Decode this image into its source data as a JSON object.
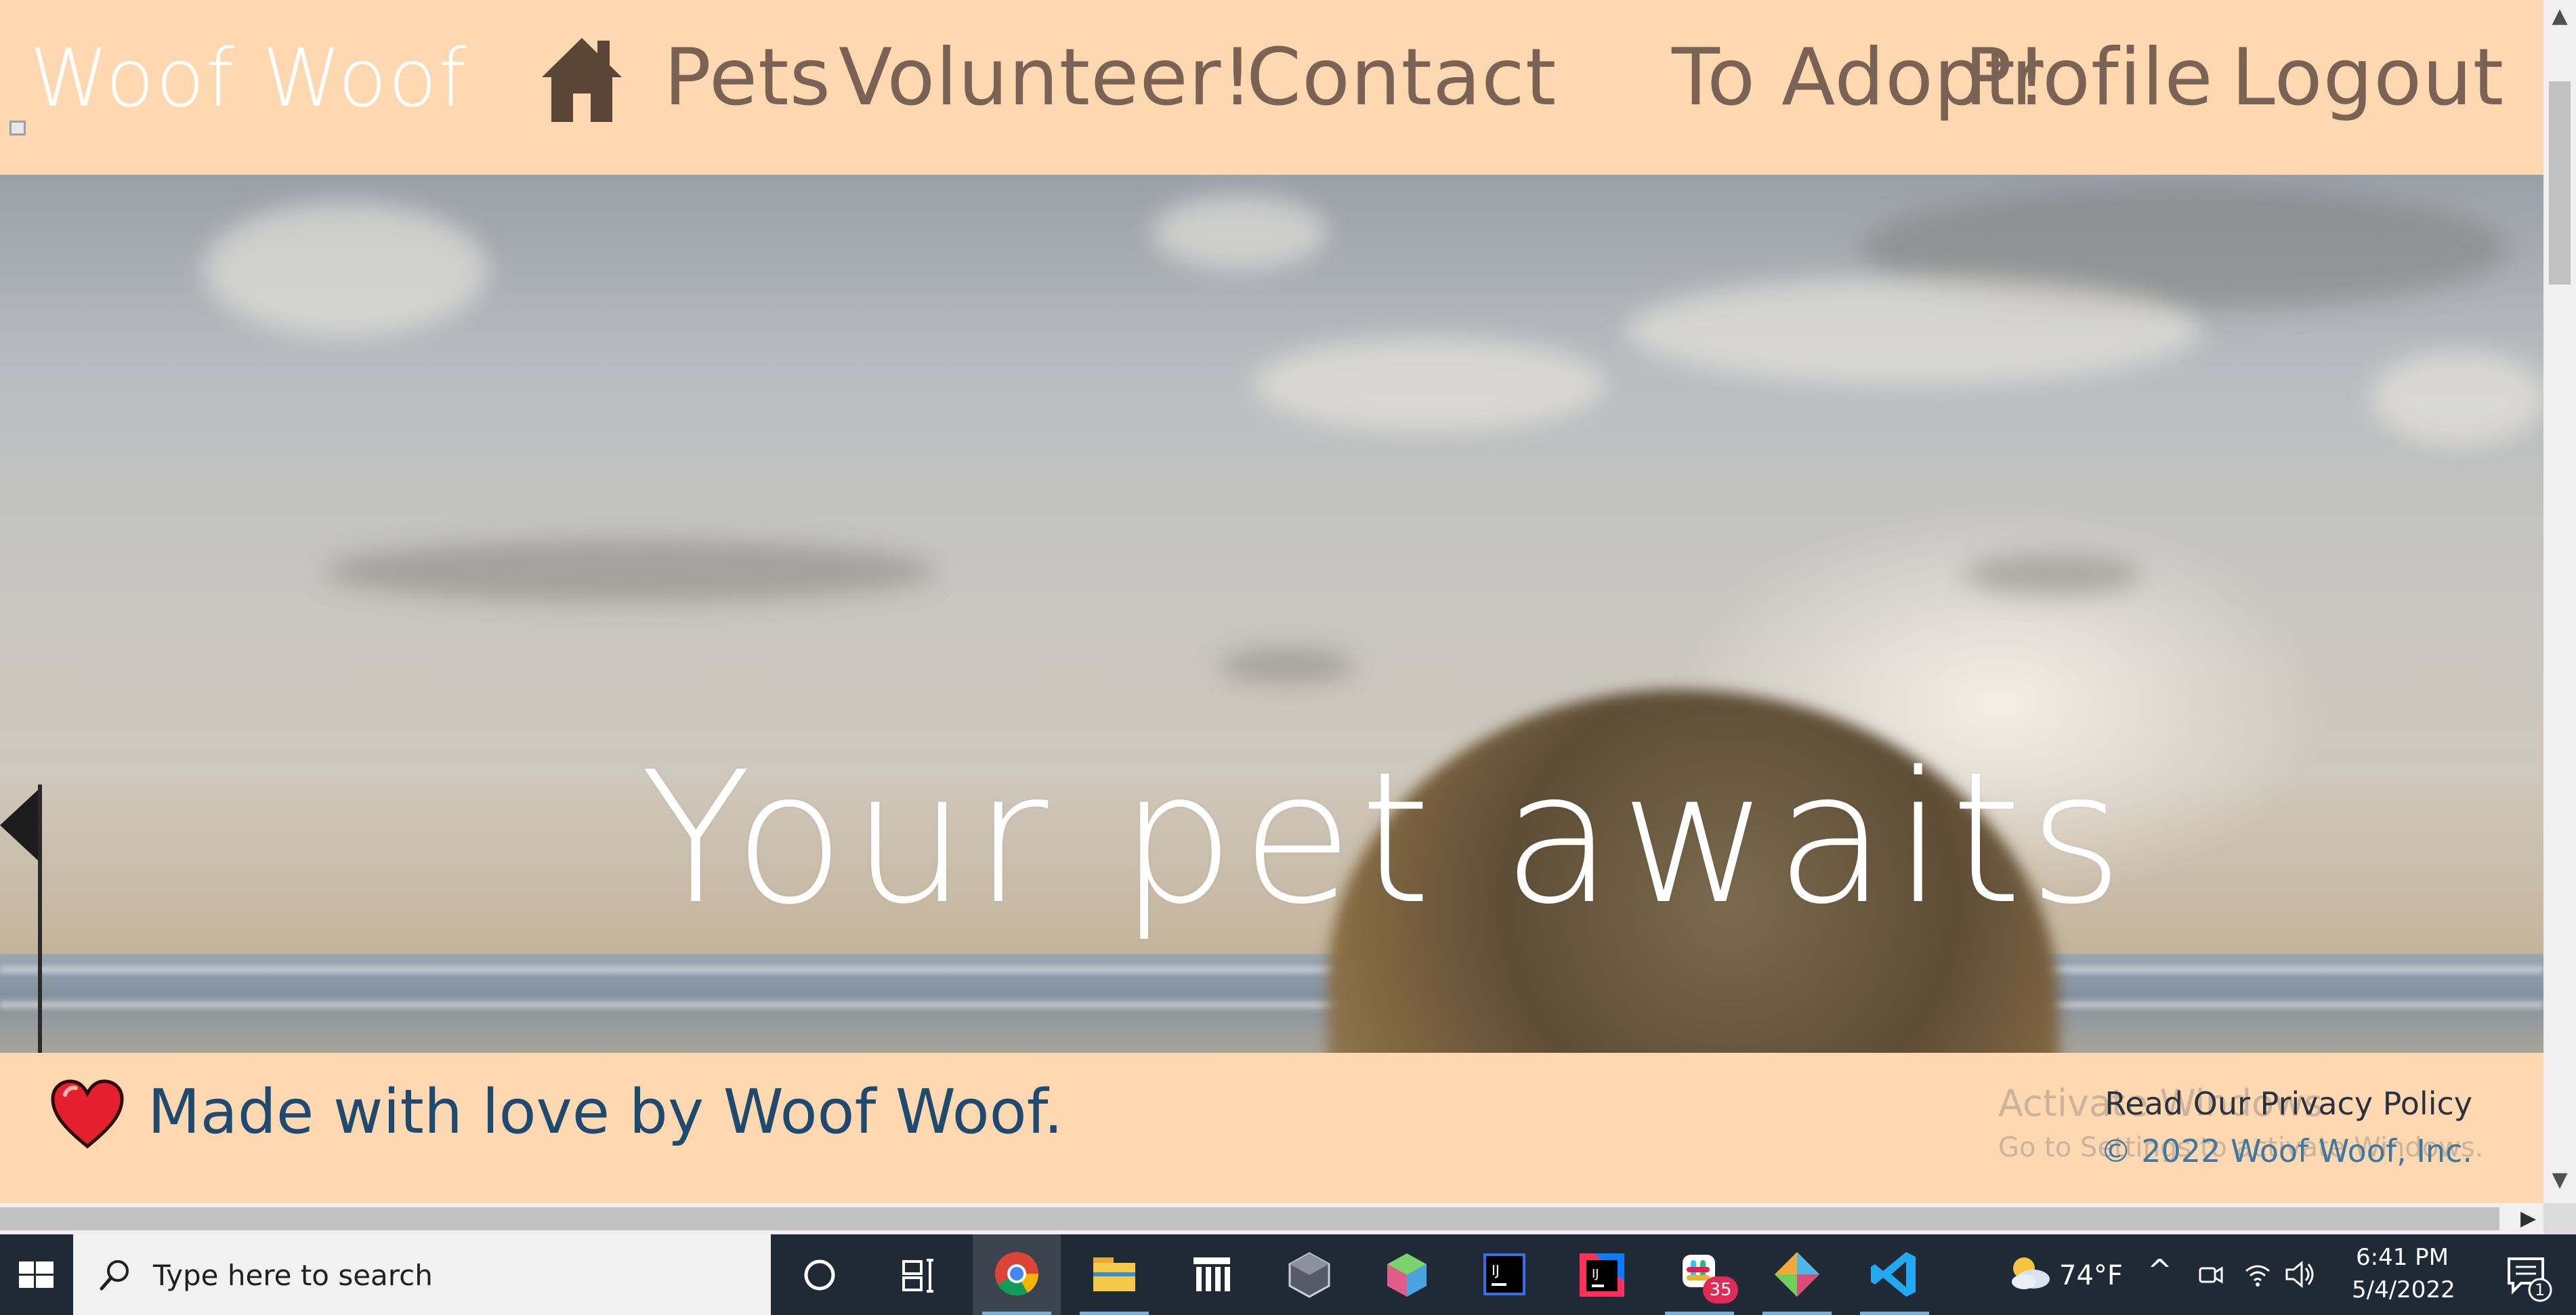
{
  "navbar": {
    "brand": "Woof Woof",
    "links": [
      "Pets",
      "Volunteer!",
      "Contact",
      "To Adopt!",
      "Profile",
      "Logout"
    ]
  },
  "hero": {
    "title": "Your pet awaits"
  },
  "footer": {
    "love_text": "Made with love by Woof Woof.",
    "privacy_link": "Read Our Privacy Policy",
    "copyright": "© 2022 Woof Woof, Inc.",
    "watermark_title": "Activate Windows",
    "watermark_sub": "Go to Settings to activate Windows."
  },
  "taskbar": {
    "search_placeholder": "Type here to search",
    "weather": "74°F",
    "time": "6:41 PM",
    "date": "5/4/2022",
    "slack_badge": "35",
    "notification_count": "1",
    "apps": [
      "cortana",
      "task-view",
      "chrome",
      "file-explorer",
      "app-bars",
      "unity",
      "app-cube",
      "intellij",
      "intellij-ultimate",
      "slack",
      "app-git",
      "vscode"
    ]
  },
  "colors": {
    "nav_background": "#fdd8b0",
    "nav_text": "#7a6354",
    "footer_text": "#1d4a6e",
    "copyright": "#3f78a0",
    "heart": "#e5202e"
  }
}
